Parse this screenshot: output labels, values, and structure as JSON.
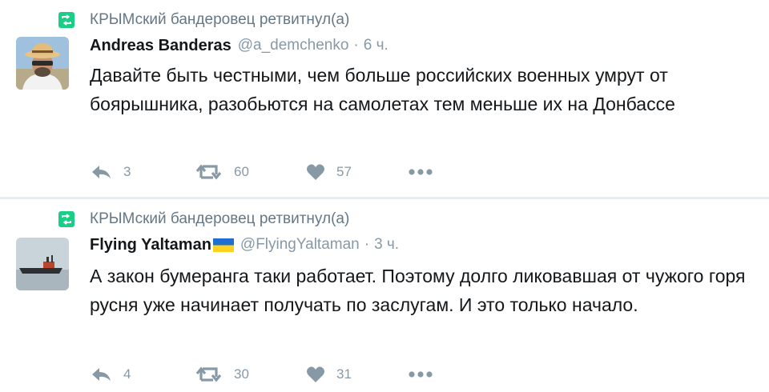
{
  "tweets": [
    {
      "retweeted_by": "КРЫМский бандеровец ретвитнул(а)",
      "name": "Andreas Banderas",
      "handle": "@a_demchenko",
      "time": "6 ч.",
      "text": "Давайте быть честными, чем больше российских военных умрут от боярышника, разобьются на самолетах тем меньше их на Донбассе",
      "replies": "3",
      "retweets": "60",
      "likes": "57"
    },
    {
      "retweeted_by": "КРЫМский бандеровец ретвитнул(а)",
      "name": "Flying Yaltaman",
      "handle": "@FlyingYaltaman",
      "time": "3 ч.",
      "text": "А закон бумеранга таки работает. Поэтому долго ликовавшая от чужого горя русня уже начинает получать по заслугам. И это только начало.",
      "replies": "4",
      "retweets": "30",
      "likes": "31"
    }
  ],
  "colors": {
    "retweet_green": "#19cf86",
    "muted": "#8899a6",
    "text": "#14171a",
    "divider": "#e6ecf0"
  },
  "icons": {
    "retweet_badge": "retweet-icon",
    "reply": "reply-icon",
    "retweet": "retweet-icon",
    "like": "heart-icon",
    "more": "more-icon"
  }
}
